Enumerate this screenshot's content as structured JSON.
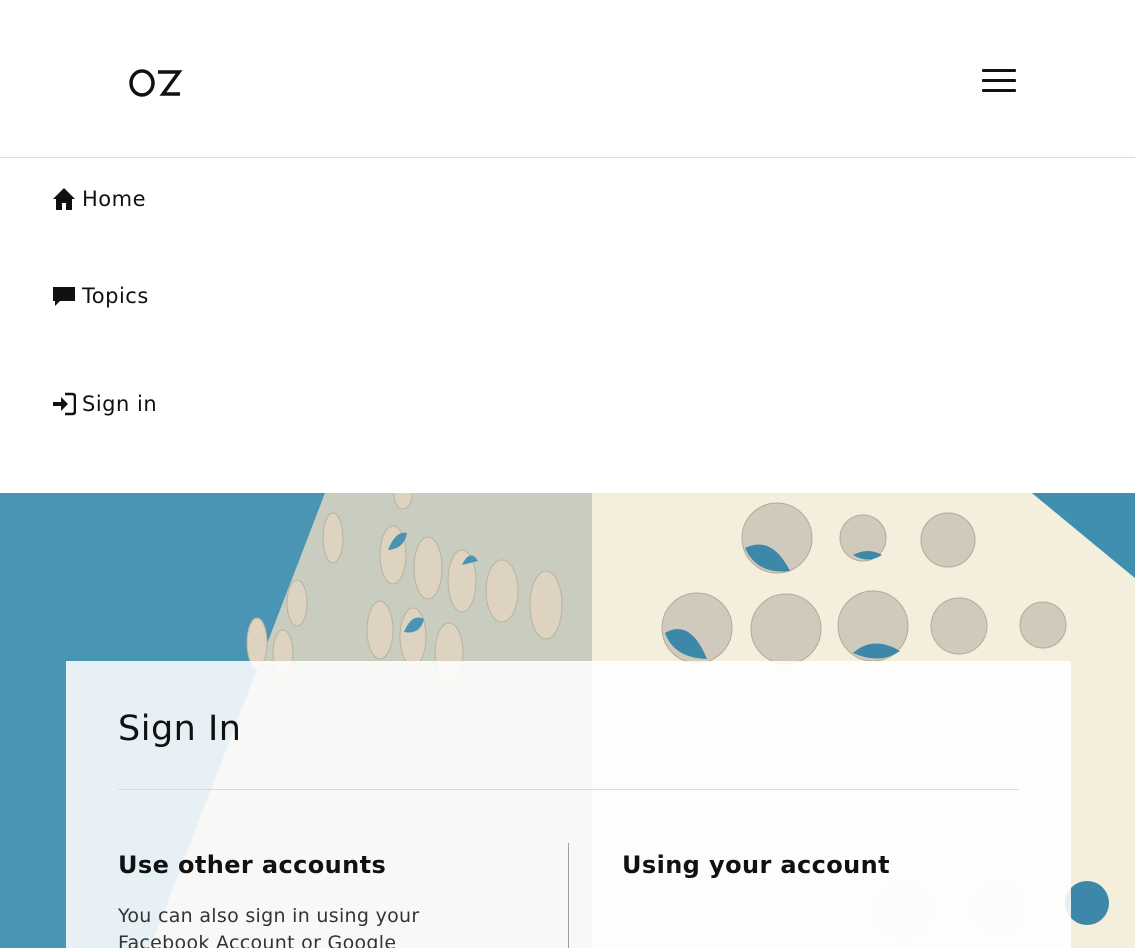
{
  "header": {
    "logo_text": "OZ",
    "menu_icon": "hamburger-menu-icon"
  },
  "nav": {
    "items": [
      {
        "label": "Home",
        "icon": "home-icon"
      },
      {
        "label": "Topics",
        "icon": "comment-icon"
      },
      {
        "label": "Sign in",
        "icon": "sign-in-icon"
      }
    ]
  },
  "signin": {
    "title": "Sign In",
    "left_heading": "Use other accounts",
    "left_description": "You can also sign in using your Facebook Account or Google",
    "right_heading": "Using your account"
  },
  "colors": {
    "hero_blue": "#4d98b6",
    "hero_beige": "#f3efdc",
    "text": "#111111"
  }
}
